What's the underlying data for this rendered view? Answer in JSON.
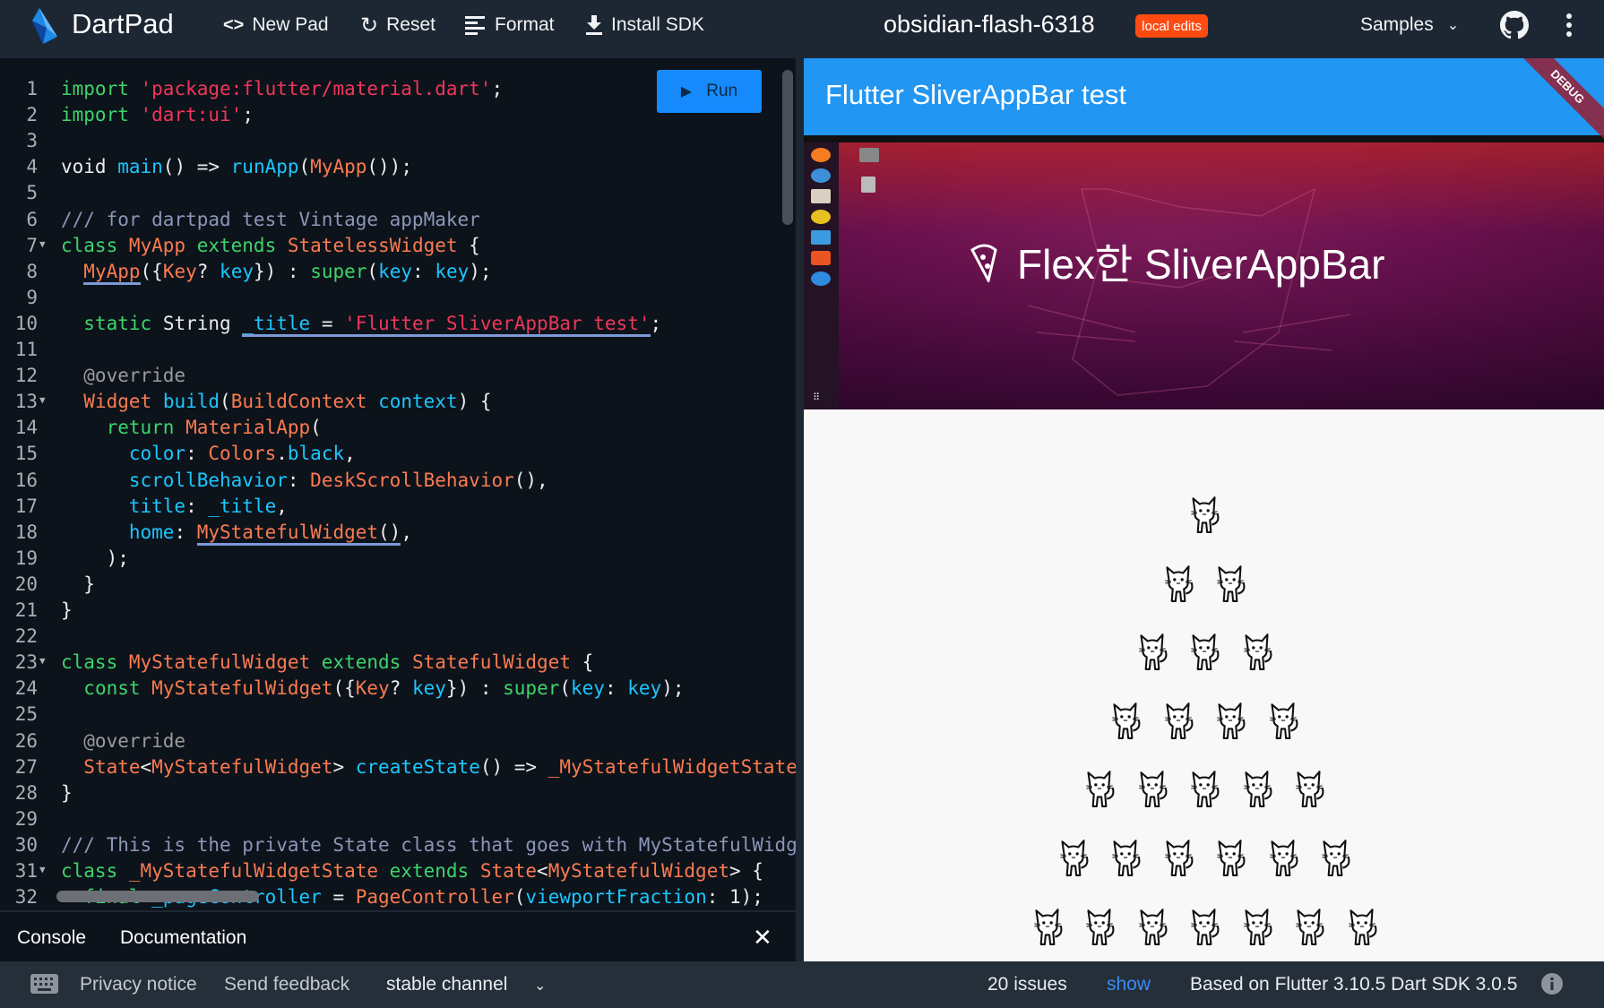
{
  "header": {
    "app_name": "DartPad",
    "new_pad": "New Pad",
    "reset": "Reset",
    "format": "Format",
    "install_sdk": "Install SDK",
    "pad_title": "obsidian-flash-6318",
    "badge": "local edits",
    "samples": "Samples",
    "badge_color": "#ff4b12"
  },
  "editor": {
    "run_label": "Run",
    "lines": [
      {
        "t": [
          [
            "kw",
            "import "
          ],
          [
            "str",
            "'package:flutter/material.dart'"
          ],
          [
            "pl",
            ";"
          ]
        ]
      },
      {
        "t": [
          [
            "kw",
            "import "
          ],
          [
            "str",
            "'dart:ui'"
          ],
          [
            "pl",
            ";"
          ]
        ]
      },
      {
        "t": []
      },
      {
        "t": [
          [
            "pl",
            "void "
          ],
          [
            "fn",
            "main"
          ],
          [
            "pl",
            "() => "
          ],
          [
            "fn",
            "runApp"
          ],
          [
            "pl",
            "("
          ],
          [
            "ty",
            "MyApp"
          ],
          [
            "pl",
            "());"
          ]
        ]
      },
      {
        "t": []
      },
      {
        "t": [
          [
            "cm",
            "/// for dartpad test Vintage appMaker"
          ]
        ]
      },
      {
        "fold": true,
        "t": [
          [
            "kw",
            "class "
          ],
          [
            "ty",
            "MyApp"
          ],
          [
            "kw",
            " extends "
          ],
          [
            "ty",
            "StatelessWidget"
          ],
          [
            "pl",
            " {"
          ]
        ]
      },
      {
        "t": [
          [
            "pl",
            "  "
          ],
          [
            "ty",
            "MyApp",
            "u"
          ],
          [
            "pl",
            "({"
          ],
          [
            "ty",
            "Key"
          ],
          [
            "pl",
            "? "
          ],
          [
            "fn",
            "key"
          ],
          [
            "pl",
            "}) : "
          ],
          [
            "kw",
            "super"
          ],
          [
            "pl",
            "("
          ],
          [
            "fn",
            "key"
          ],
          [
            "pl",
            ": "
          ],
          [
            "fn",
            "key"
          ],
          [
            "pl",
            ");"
          ]
        ]
      },
      {
        "t": []
      },
      {
        "t": [
          [
            "pl",
            "  "
          ],
          [
            "kw",
            "static "
          ],
          [
            "pl",
            "String "
          ],
          [
            "fn",
            "_title",
            "u"
          ],
          [
            "pl",
            " = ",
            "u"
          ],
          [
            "str",
            "'Flutter SliverAppBar test'",
            "u"
          ],
          [
            "pl",
            ";"
          ]
        ]
      },
      {
        "t": []
      },
      {
        "t": [
          [
            "an",
            "  @override"
          ]
        ]
      },
      {
        "fold": true,
        "t": [
          [
            "pl",
            "  "
          ],
          [
            "ty",
            "Widget "
          ],
          [
            "fn",
            "build"
          ],
          [
            "pl",
            "("
          ],
          [
            "ty",
            "BuildContext "
          ],
          [
            "fn",
            "context"
          ],
          [
            "pl",
            ") {"
          ]
        ]
      },
      {
        "t": [
          [
            "pl",
            "    "
          ],
          [
            "kw",
            "return "
          ],
          [
            "ty",
            "MaterialApp"
          ],
          [
            "pl",
            "("
          ]
        ]
      },
      {
        "t": [
          [
            "pl",
            "      "
          ],
          [
            "fn",
            "color"
          ],
          [
            "pl",
            ": "
          ],
          [
            "ty",
            "Colors"
          ],
          [
            "pl",
            "."
          ],
          [
            "fn",
            "black"
          ],
          [
            "pl",
            ","
          ]
        ]
      },
      {
        "t": [
          [
            "pl",
            "      "
          ],
          [
            "fn",
            "scrollBehavior"
          ],
          [
            "pl",
            ": "
          ],
          [
            "ty",
            "DeskScrollBehavior"
          ],
          [
            "pl",
            "(),"
          ]
        ]
      },
      {
        "t": [
          [
            "pl",
            "      "
          ],
          [
            "fn",
            "title"
          ],
          [
            "pl",
            ": "
          ],
          [
            "fn",
            "_title"
          ],
          [
            "pl",
            ","
          ]
        ]
      },
      {
        "t": [
          [
            "pl",
            "      "
          ],
          [
            "fn",
            "home"
          ],
          [
            "pl",
            ": "
          ],
          [
            "ty",
            "MyStatefulWidget",
            "u"
          ],
          [
            "pl",
            "()",
            "u"
          ],
          [
            "pl",
            ","
          ]
        ]
      },
      {
        "t": [
          [
            "pl",
            "    );"
          ]
        ]
      },
      {
        "t": [
          [
            "pl",
            "  }"
          ]
        ]
      },
      {
        "t": [
          [
            "pl",
            "}"
          ]
        ]
      },
      {
        "t": []
      },
      {
        "fold": true,
        "t": [
          [
            "kw",
            "class "
          ],
          [
            "ty",
            "MyStatefulWidget"
          ],
          [
            "kw",
            " extends "
          ],
          [
            "ty",
            "StatefulWidget"
          ],
          [
            "pl",
            " {"
          ]
        ]
      },
      {
        "t": [
          [
            "pl",
            "  "
          ],
          [
            "kw",
            "const "
          ],
          [
            "ty",
            "MyStatefulWidget"
          ],
          [
            "pl",
            "({"
          ],
          [
            "ty",
            "Key"
          ],
          [
            "pl",
            "? "
          ],
          [
            "fn",
            "key"
          ],
          [
            "pl",
            "}) : "
          ],
          [
            "kw",
            "super"
          ],
          [
            "pl",
            "("
          ],
          [
            "fn",
            "key"
          ],
          [
            "pl",
            ": "
          ],
          [
            "fn",
            "key"
          ],
          [
            "pl",
            ");"
          ]
        ]
      },
      {
        "t": []
      },
      {
        "t": [
          [
            "an",
            "  @override"
          ]
        ]
      },
      {
        "t": [
          [
            "pl",
            "  "
          ],
          [
            "ty",
            "State"
          ],
          [
            "pl",
            "<"
          ],
          [
            "ty",
            "MyStatefulWidget"
          ],
          [
            "pl",
            "> "
          ],
          [
            "fn",
            "createState"
          ],
          [
            "pl",
            "() => "
          ],
          [
            "ty",
            "_MyStatefulWidgetState"
          ],
          [
            "pl",
            "();"
          ]
        ]
      },
      {
        "t": [
          [
            "pl",
            "}"
          ]
        ]
      },
      {
        "t": []
      },
      {
        "t": [
          [
            "cm",
            "/// This is the private State class that goes with MyStatefulWidget."
          ]
        ]
      },
      {
        "fold": true,
        "t": [
          [
            "kw",
            "class "
          ],
          [
            "ty",
            "_MyStatefulWidgetState"
          ],
          [
            "kw",
            " extends "
          ],
          [
            "ty",
            "State"
          ],
          [
            "pl",
            "<"
          ],
          [
            "ty",
            "MyStatefulWidget"
          ],
          [
            "pl",
            "> {"
          ]
        ]
      },
      {
        "t": [
          [
            "pl",
            "  "
          ],
          [
            "kw",
            "final "
          ],
          [
            "fn",
            "_pageController"
          ],
          [
            "pl",
            " = "
          ],
          [
            "ty",
            "PageController"
          ],
          [
            "pl",
            "("
          ],
          [
            "fn",
            "viewportFraction"
          ],
          [
            "pl",
            ": 1);"
          ]
        ]
      }
    ]
  },
  "console": {
    "console_tab": "Console",
    "docs_tab": "Documentation"
  },
  "status": {
    "privacy": "Privacy notice",
    "feedback": "Send feedback",
    "channel": "stable channel",
    "issues": "20 issues",
    "show": "show",
    "version": "Based on Flutter 3.10.5 Dart SDK 3.0.5"
  },
  "preview": {
    "appbar_title": "Flutter SliverAppBar test",
    "debug_banner": "DEBUG",
    "hero_title": "Flex한 SliverAppBar",
    "appbar_color": "#2196f3",
    "cat_rows": [
      1,
      2,
      3,
      4,
      5,
      6,
      7
    ]
  }
}
